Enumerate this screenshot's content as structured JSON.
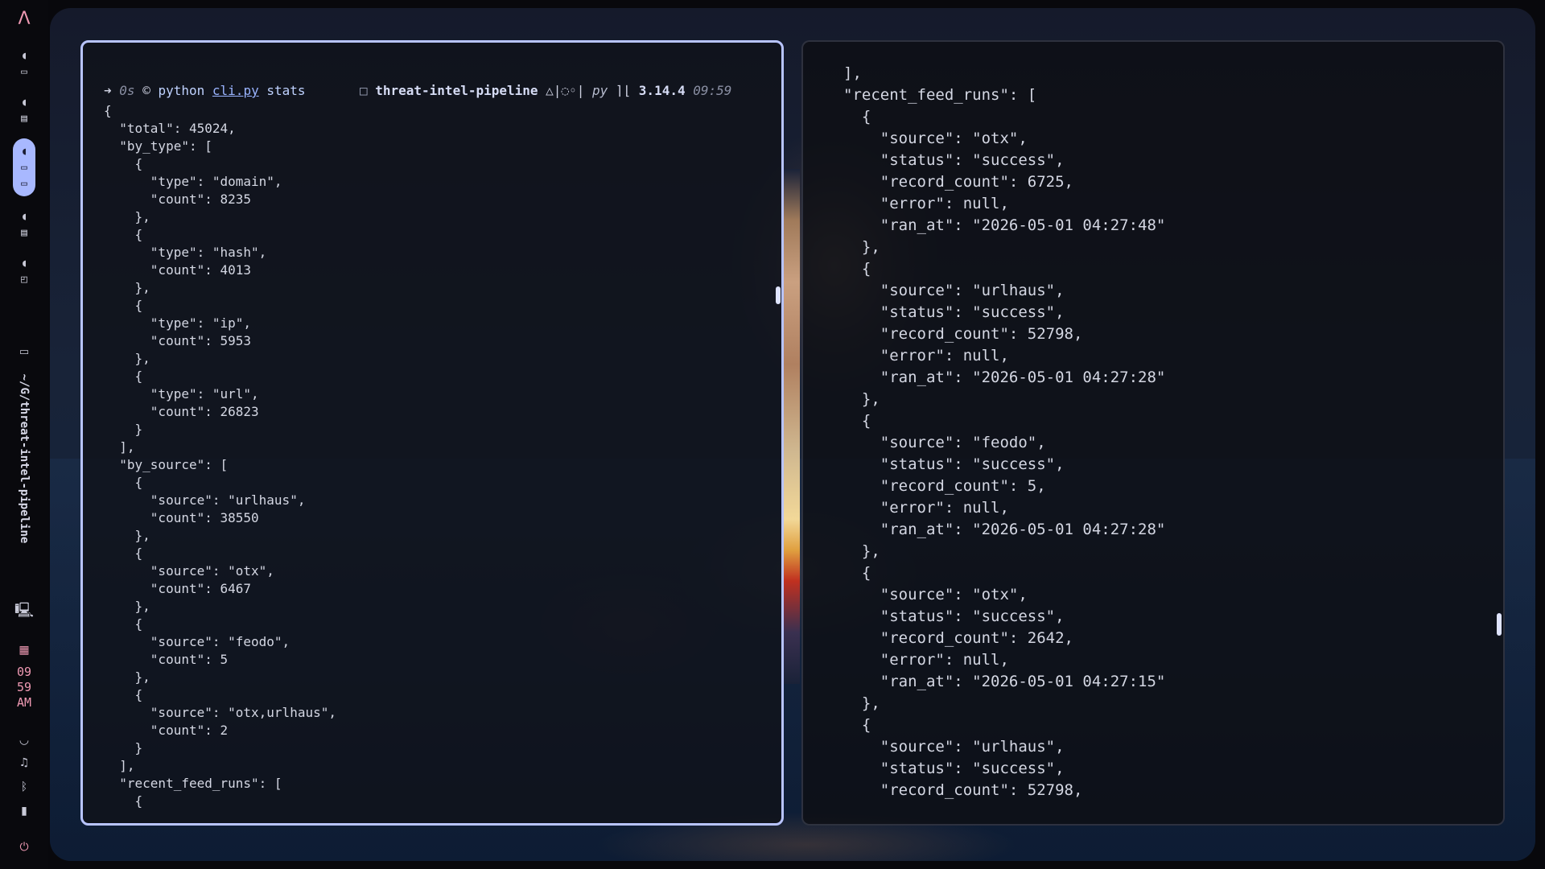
{
  "sidebar": {
    "logo": "Λ",
    "workspaces": [
      {
        "icons": [
          "◖",
          "▭"
        ],
        "active": false
      },
      {
        "icons": [
          "◖",
          "▤"
        ],
        "active": false
      },
      {
        "icons": [
          "◖",
          "▭",
          "▭"
        ],
        "active": true
      },
      {
        "icons": [
          "◖",
          "▤"
        ],
        "active": false
      },
      {
        "icons": [
          "◖",
          "◰"
        ],
        "active": false
      }
    ],
    "terminal_icon": "▭",
    "path": "~/G/threat-intel-pipeline",
    "monitor_icon": "🖳",
    "calendar_icon": "▦",
    "clock": {
      "hour": "09",
      "minute": "59",
      "ampm": "AM"
    },
    "tray": {
      "wifi": "◡",
      "audio": "♫",
      "bluetooth": "ᛒ",
      "power": "⏻"
    }
  },
  "terminal_left": {
    "prompt": {
      "arrow": "➜",
      "duration": "0s",
      "symbol": "©",
      "command": "python",
      "file": "cli.py",
      "args": "stats",
      "dir_icon": "□",
      "directory": "threat-intel-pipeline",
      "git_status": "△|◌◦|",
      "lang": "py",
      "version_icon": "⌉⌊",
      "version": "3.14.4",
      "time": "09:59"
    },
    "output": "{\n  \"total\": 45024,\n  \"by_type\": [\n    {\n      \"type\": \"domain\",\n      \"count\": 8235\n    },\n    {\n      \"type\": \"hash\",\n      \"count\": 4013\n    },\n    {\n      \"type\": \"ip\",\n      \"count\": 5953\n    },\n    {\n      \"type\": \"url\",\n      \"count\": 26823\n    }\n  ],\n  \"by_source\": [\n    {\n      \"source\": \"urlhaus\",\n      \"count\": 38550\n    },\n    {\n      \"source\": \"otx\",\n      \"count\": 6467\n    },\n    {\n      \"source\": \"feodo\",\n      \"count\": 5\n    },\n    {\n      \"source\": \"otx,urlhaus\",\n      \"count\": 2\n    }\n  ],\n  \"recent_feed_runs\": [\n    {"
  },
  "terminal_right": {
    "output": "],\n\"recent_feed_runs\": [\n  {\n    \"source\": \"otx\",\n    \"status\": \"success\",\n    \"record_count\": 6725,\n    \"error\": null,\n    \"ran_at\": \"2026-05-01 04:27:48\"\n  },\n  {\n    \"source\": \"urlhaus\",\n    \"status\": \"success\",\n    \"record_count\": 52798,\n    \"error\": null,\n    \"ran_at\": \"2026-05-01 04:27:28\"\n  },\n  {\n    \"source\": \"feodo\",\n    \"status\": \"success\",\n    \"record_count\": 5,\n    \"error\": null,\n    \"ran_at\": \"2026-05-01 04:27:28\"\n  },\n  {\n    \"source\": \"otx\",\n    \"status\": \"success\",\n    \"record_count\": 2642,\n    \"error\": null,\n    \"ran_at\": \"2026-05-01 04:27:15\"\n  },\n  {\n    \"source\": \"urlhaus\",\n    \"status\": \"success\",\n    \"record_count\": 52798,"
  },
  "colors": {
    "active_border": "#b8c4ff",
    "accent_pink": "#f09ab4",
    "workspace_active": "#a8b8ff"
  }
}
